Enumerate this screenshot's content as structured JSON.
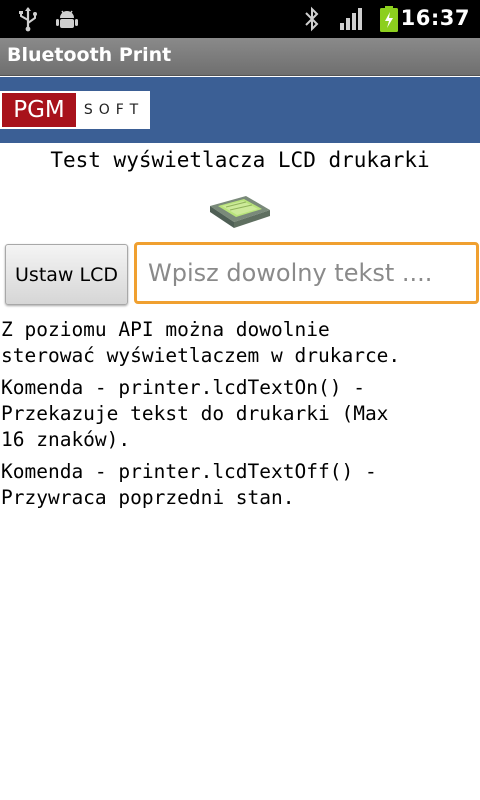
{
  "status_bar": {
    "time": "16:37",
    "icons": [
      "usb-icon",
      "debug-icon",
      "bluetooth-icon",
      "signal-icon",
      "battery-charging-icon"
    ]
  },
  "app": {
    "title": "Bluetooth Print"
  },
  "logo": {
    "part_a": "PGM",
    "part_b": "SOFT",
    "colors": {
      "red": "#a8121b",
      "banner": "#3b5f95"
    }
  },
  "main": {
    "heading": "Test wyświetlacza LCD drukarki",
    "device_image_icon": "lcd-device-icon",
    "set_lcd_button": "Ustaw LCD",
    "text_input": {
      "value": "",
      "placeholder": "Wpisz dowolny tekst ...."
    },
    "descriptions": [
      [
        "Z poziomu API można dowolnie",
        "sterować wyświetlaczem w drukarce."
      ],
      [
        "Komenda  - printer.lcdTextOn() -",
        "Przekazuje tekst do drukarki (Max",
        "16 znaków)."
      ],
      [
        "Komenda  - printer.lcdTextOff() -",
        "Przywraca poprzedni stan."
      ]
    ]
  },
  "accent_color": "#f0a030"
}
